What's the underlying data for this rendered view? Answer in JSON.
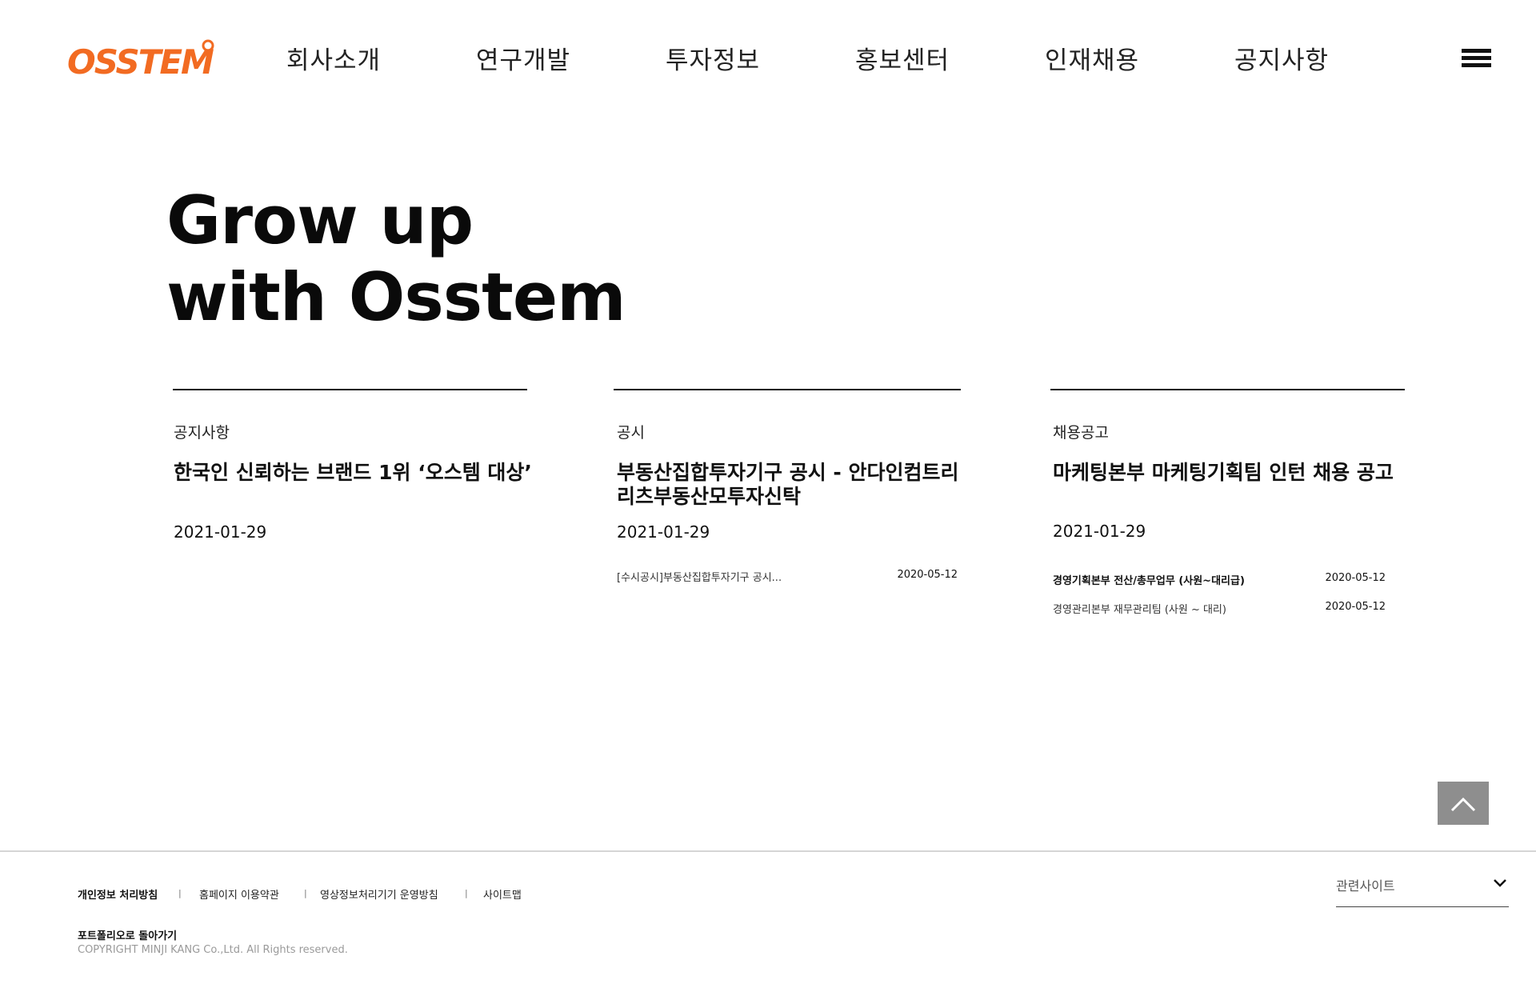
{
  "brand": {
    "logo_text": "OSSTEM",
    "accent_color": "#f26b22"
  },
  "nav": {
    "items": [
      {
        "label": "회사소개"
      },
      {
        "label": "연구개발"
      },
      {
        "label": "투자정보"
      },
      {
        "label": "홍보센터"
      },
      {
        "label": "인재채용"
      },
      {
        "label": "공지사항"
      }
    ],
    "menu_icon": "hamburger-icon"
  },
  "hero": {
    "line1": "Grow up",
    "line2": "with Osstem"
  },
  "cards": [
    {
      "category": "공지사항",
      "title": "한국인 신뢰하는 브랜드 1위 ‘오스템 대상’",
      "date": "2021-01-29",
      "items": []
    },
    {
      "category": "공시",
      "title": "부동산집합투자기구 공시 - 안다인컴트리리츠부동산모투자신탁",
      "date": "2021-01-29",
      "items": [
        {
          "title": "[수시공시]부동산집합투자기구 공시...",
          "date": "2020-05-12"
        }
      ]
    },
    {
      "category": "채용공고",
      "title": "마케팅본부 마케팅기획팀 인턴 채용 공고",
      "date": "2021-01-29",
      "items": [
        {
          "title": "경영기획본부 전산/총무업무 (사원~대리급)",
          "date": "2020-05-12"
        },
        {
          "title": "경영관리본부 재무관리팀 (사원 ~ 대리)",
          "date": "2020-05-12"
        }
      ]
    }
  ],
  "top_button": {
    "icon": "chevron-up-icon",
    "color": "#8e8e8e"
  },
  "footer": {
    "links": [
      {
        "label": "개인정보 처리방침"
      },
      {
        "label": "홈페이지 이용약관"
      },
      {
        "label": "영상정보처리기기 운영방침"
      },
      {
        "label": "사이트맵"
      }
    ],
    "separator": "|",
    "portfolio_link": "포트폴리오로 돌아가기",
    "copyright": "COPYRIGHT MINJI KANG Co.,Ltd. All Rights reserved.",
    "related_sites": {
      "label": "관련사이트",
      "icon": "chevron-down-icon"
    }
  }
}
